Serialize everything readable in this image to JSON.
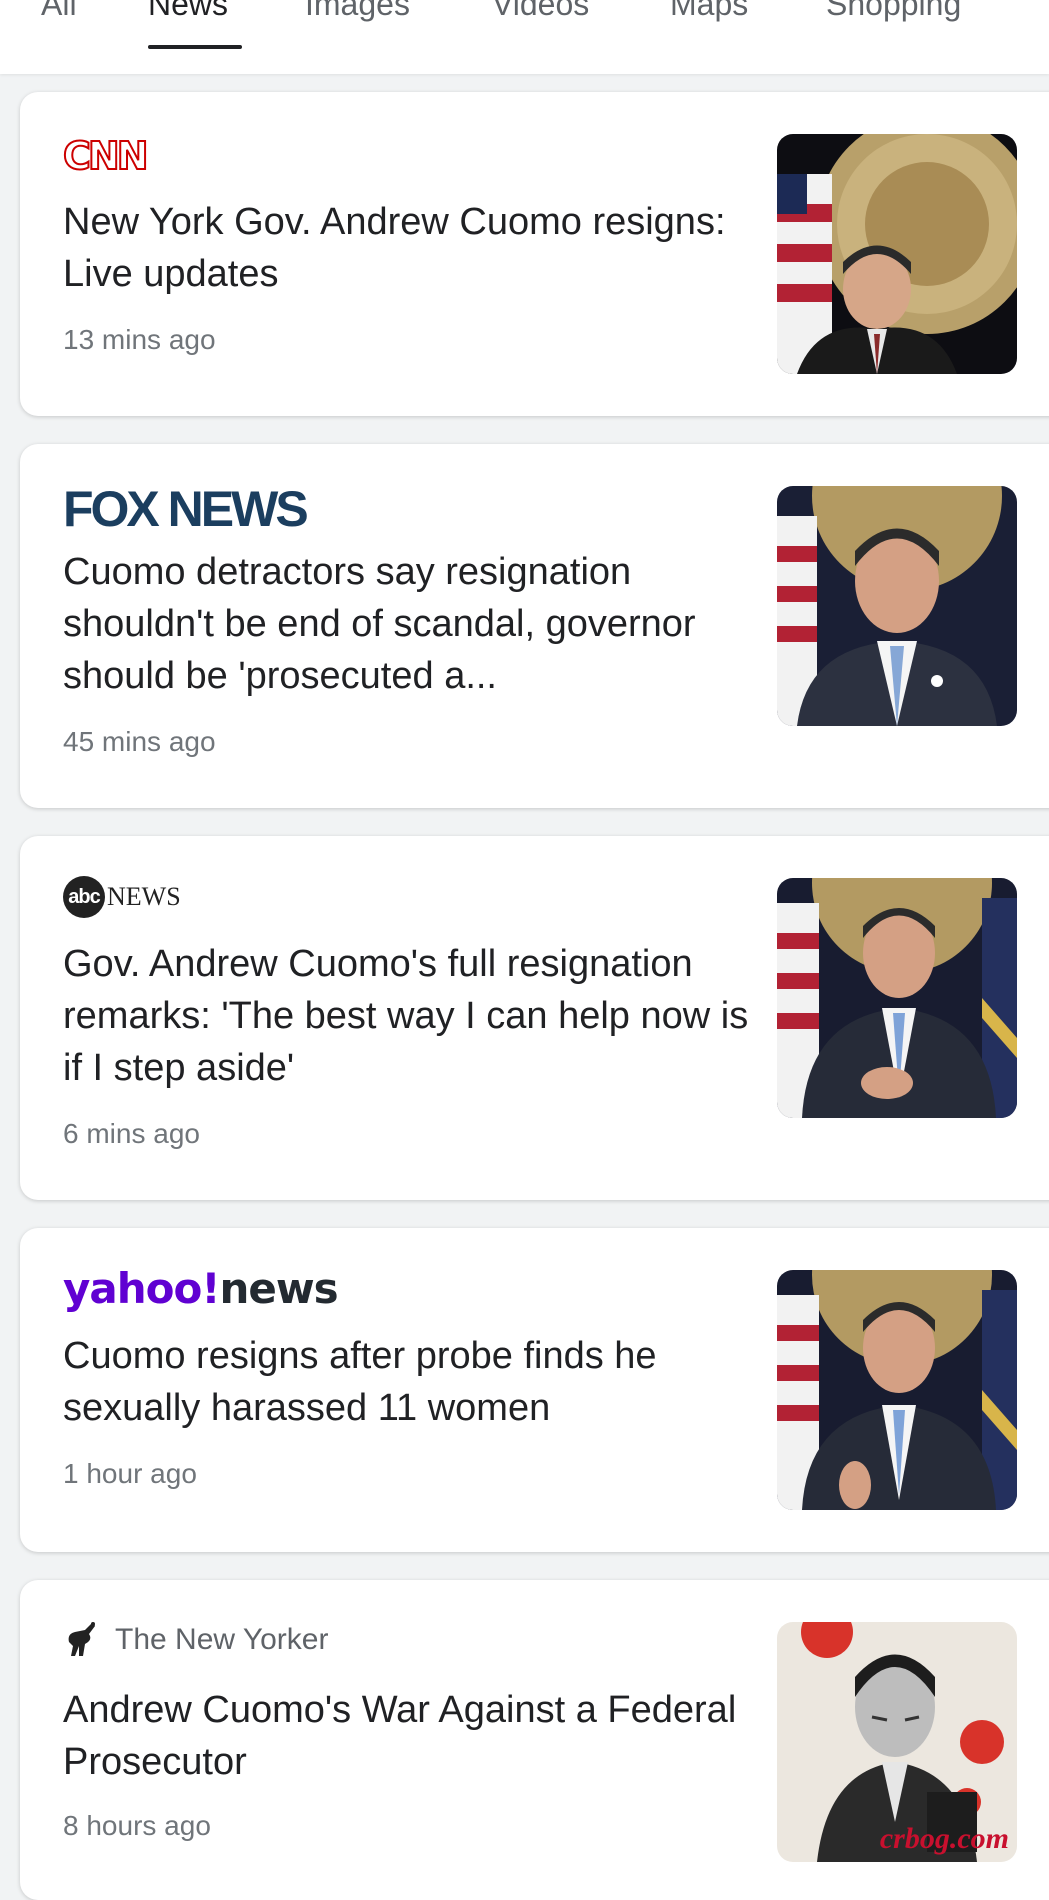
{
  "tabs": [
    {
      "label": "All",
      "active": false
    },
    {
      "label": "News",
      "active": true
    },
    {
      "label": "Images",
      "active": false
    },
    {
      "label": "Videos",
      "active": false
    },
    {
      "label": "Maps",
      "active": false
    },
    {
      "label": "Shopping",
      "active": false
    }
  ],
  "articles": [
    {
      "source": "CNN",
      "headline": "New York Gov. Andrew Cuomo resigns: Live updates",
      "time": "13 mins ago",
      "thumbnail": "cuomo-seal-photo"
    },
    {
      "source": "FOX NEWS",
      "headline": "Cuomo detractors say resignation shouldn't be end of scandal, governor should be 'prosecuted a...",
      "time": "45 mins ago",
      "thumbnail": "cuomo-portrait-photo"
    },
    {
      "source_logo": "abc",
      "source": "NEWS",
      "headline": "Gov. Andrew Cuomo's full resignation remarks: 'The best way I can help now is if I step aside'",
      "time": "6 mins ago",
      "thumbnail": "cuomo-speaking-photo"
    },
    {
      "source_logo": "yahoo!",
      "source": "news",
      "headline": "Cuomo resigns after probe finds he sexually harassed 11 women",
      "time": "1 hour ago",
      "thumbnail": "cuomo-gesture-photo"
    },
    {
      "source": "The New Yorker",
      "headline": "Andrew Cuomo's War Against a Federal Prosecutor",
      "time": "8 hours ago",
      "thumbnail": "cuomo-illustration",
      "thumbnail_watermark": "crbog.com"
    }
  ],
  "colors": {
    "cnn": "#cc0000",
    "fox": "#1b3e5f",
    "yahoo": "#6001d2",
    "time_text": "#70757a"
  }
}
